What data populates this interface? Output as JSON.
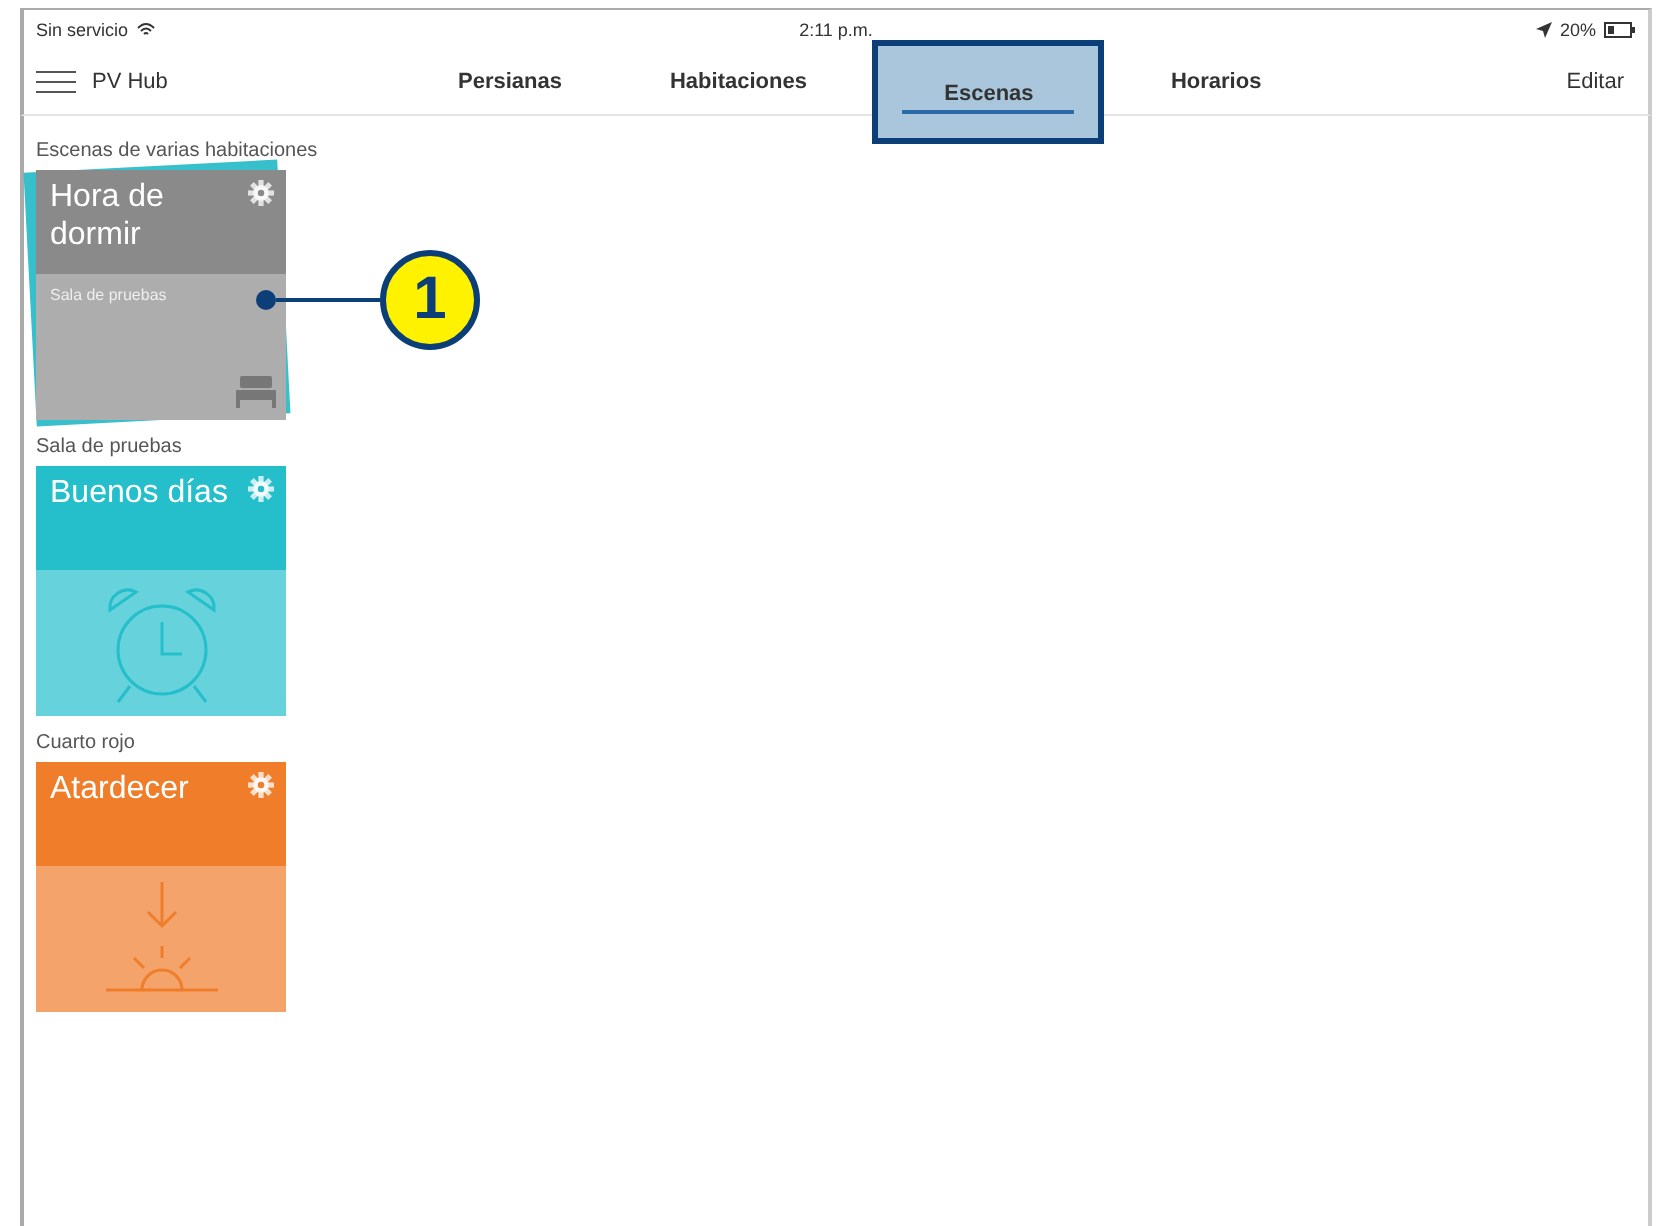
{
  "status_bar": {
    "carrier": "Sin servicio",
    "time": "2:11 p.m.",
    "battery": "20%"
  },
  "nav": {
    "title": "PV Hub",
    "edit": "Editar",
    "tabs": [
      {
        "label": "Persianas",
        "selected": false
      },
      {
        "label": "Habitaciones",
        "selected": false
      },
      {
        "label": "Escenas",
        "selected": true
      },
      {
        "label": "Horarios",
        "selected": false
      }
    ]
  },
  "sections": [
    {
      "title": "Escenas de varias habitaciones",
      "scenes": [
        {
          "name": "Hora de dormir",
          "room": "Sala de pruebas",
          "kind": "bed",
          "stacked": true,
          "color": "#8a8a8a",
          "callout": "1"
        }
      ]
    },
    {
      "title": "Sala de pruebas",
      "scenes": [
        {
          "name": "Buenos días",
          "kind": "clock",
          "stacked": false,
          "color": "#25bfcc"
        }
      ]
    },
    {
      "title": "Cuarto rojo",
      "scenes": [
        {
          "name": "Atardecer",
          "kind": "sunset",
          "stacked": false,
          "color": "#ef7d2a"
        }
      ]
    }
  ]
}
